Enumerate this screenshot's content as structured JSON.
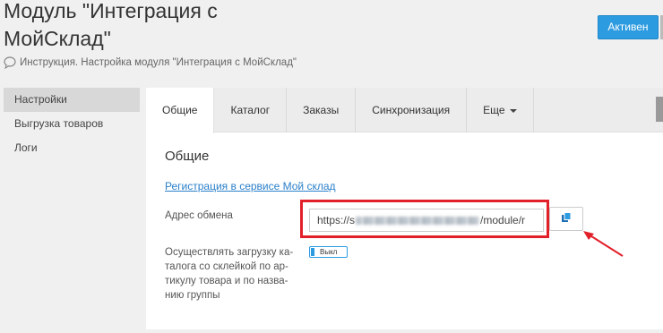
{
  "header": {
    "title_line1": "Модуль \"Интеграция с",
    "title_line2": "МойСклад\"",
    "subtitle": "Инструкция. Настройка модуля \"Интеграция с МойСклад\"",
    "status_button": "Активен"
  },
  "sidebar": {
    "items": [
      {
        "label": "Настройки",
        "active": true
      },
      {
        "label": "Выгрузка товаров",
        "active": false
      },
      {
        "label": "Логи",
        "active": false
      }
    ]
  },
  "tabs": [
    {
      "label": "Общие",
      "active": true
    },
    {
      "label": "Каталог",
      "active": false
    },
    {
      "label": "Заказы",
      "active": false
    },
    {
      "label": "Синхронизация",
      "active": false
    },
    {
      "label": "Еще",
      "active": false
    }
  ],
  "general": {
    "section_title": "Общие",
    "registration_link": "Регистрация в сервисе Мой склад",
    "exchange_label": "Адрес обмена",
    "exchange_url_start": "https://s",
    "exchange_url_end": "/module/r",
    "load_label": "Осуществлять загрузку ка-\nталога со склейкой по ар-\nтикулу товара и по назва-\nнию группы",
    "toggle_label": "Выкл"
  },
  "icons": {
    "subtitle_icon": "chat-bubble-icon",
    "copy_icon": "copy-icon",
    "tab_caret": "caret-down-icon"
  },
  "colors": {
    "accent": "#2d9be0",
    "highlight": "#e2202a",
    "link": "#2a7fc9"
  }
}
